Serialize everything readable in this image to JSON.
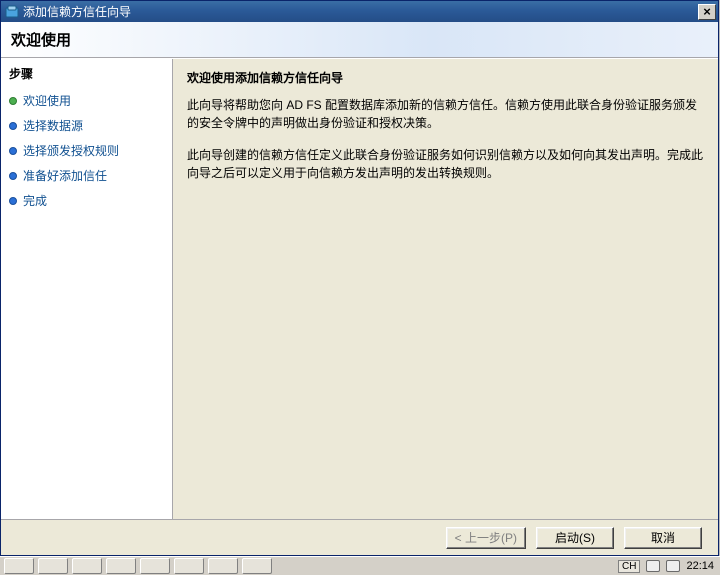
{
  "titlebar": {
    "title": "添加信赖方信任向导",
    "close_label": "×"
  },
  "banner": {
    "heading": "欢迎使用"
  },
  "sidebar": {
    "heading": "步骤",
    "steps": [
      {
        "label": "欢迎使用",
        "current": true
      },
      {
        "label": "选择数据源",
        "current": false
      },
      {
        "label": "选择颁发授权规则",
        "current": false
      },
      {
        "label": "准备好添加信任",
        "current": false
      },
      {
        "label": "完成",
        "current": false
      }
    ]
  },
  "content": {
    "heading": "欢迎使用添加信赖方信任向导",
    "p1": "此向导将帮助您向 AD FS 配置数据库添加新的信赖方信任。信赖方使用此联合身份验证服务颁发的安全令牌中的声明做出身份验证和授权决策。",
    "p2": "此向导创建的信赖方信任定义此联合身份验证服务如何识别信赖方以及如何向其发出声明。完成此向导之后可以定义用于向信赖方发出声明的发出转换规则。"
  },
  "footer": {
    "prev": "< 上一步(P)",
    "start": "启动(S)",
    "cancel": "取消"
  },
  "taskbar": {
    "lang": "CH",
    "clock": "22:14"
  }
}
